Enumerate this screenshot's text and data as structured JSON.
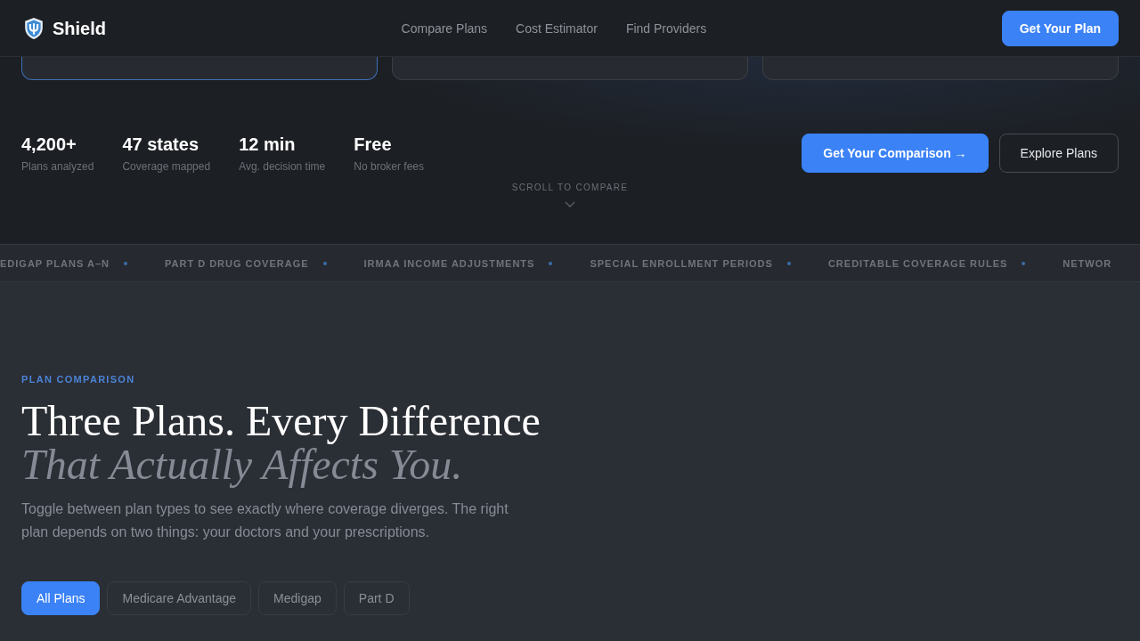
{
  "header": {
    "brand": "Shield",
    "nav": [
      "Compare Plans",
      "Cost Estimator",
      "Find Providers"
    ],
    "cta": "Get Your Plan"
  },
  "plan_cards": [
    {
      "selected": true
    },
    {
      "selected": false
    },
    {
      "selected": false
    }
  ],
  "hero": {
    "stats": [
      {
        "value": "4,200+",
        "label": "Plans analyzed"
      },
      {
        "value": "47 states",
        "label": "Coverage mapped"
      },
      {
        "value": "12 min",
        "label": "Avg. decision time"
      },
      {
        "value": "Free",
        "label": "No broker fees"
      }
    ],
    "buttons": [
      {
        "label": "Get Your Comparison →",
        "kind": "primary"
      },
      {
        "label": "Explore Plans",
        "kind": "secondary"
      }
    ],
    "scroll_hint": "SCROLL TO COMPARE"
  },
  "ticker": [
    "EDIGAP PLANS A–N",
    "PART D DRUG COVERAGE",
    "IRMAA INCOME ADJUSTMENTS",
    "SPECIAL ENROLLMENT PERIODS",
    "CREDITABLE COVERAGE RULES",
    "NETWOR"
  ],
  "comparison": {
    "eyebrow": "PLAN COMPARISON",
    "title": "Three Plans. Every Difference",
    "title_italic": "That Actually Affects You.",
    "description": "Toggle between plan types to see exactly where coverage diverges. The right plan depends on two things: your doctors and your prescriptions.",
    "tabs": [
      {
        "label": "All Plans",
        "selected": true
      },
      {
        "label": "Medicare Advantage",
        "selected": false
      },
      {
        "label": "Medigap",
        "selected": false
      },
      {
        "label": "Part D",
        "selected": false
      }
    ]
  }
}
